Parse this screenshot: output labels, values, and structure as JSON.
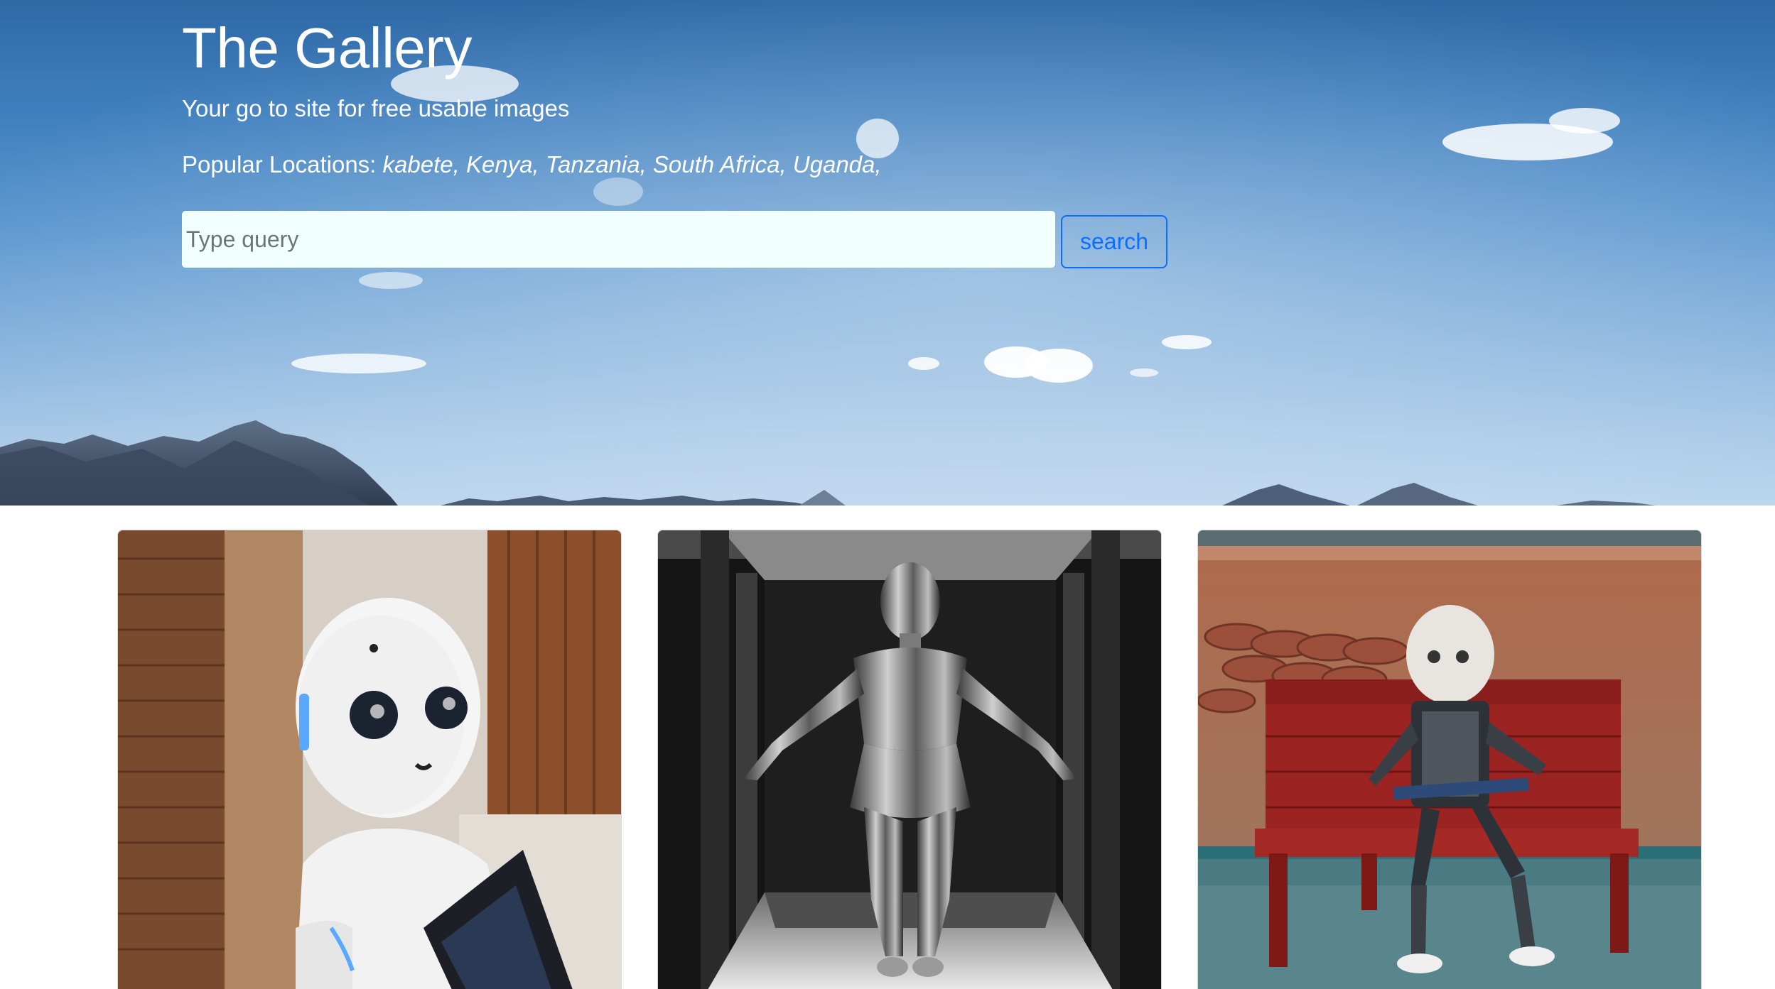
{
  "hero": {
    "title": "The Gallery",
    "tagline": "Your go to site for free usable images",
    "locations_label": "Popular Locations:",
    "locations_list": "kabete, Kenya, Tanzania, South Africa, Uganda,"
  },
  "search": {
    "placeholder": "Type query",
    "value": "",
    "button_label": "search"
  },
  "gallery": {
    "images": [
      {
        "subject": "white humanoid robot holding a tablet"
      },
      {
        "subject": "chrome female robot figure in a dark corridor"
      },
      {
        "subject": "skeletal robot sitting on a red bench reading"
      }
    ]
  },
  "colors": {
    "search_button_accent": "#0d6efd",
    "search_input_bg": "#f1ffff",
    "hero_text": "#ffffff"
  }
}
